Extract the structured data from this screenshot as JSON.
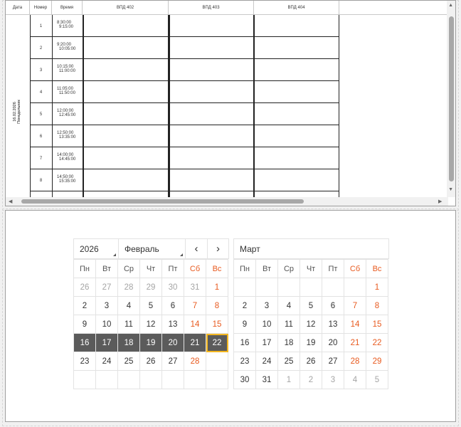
{
  "schedule": {
    "columns": [
      "Дата",
      "Номер",
      "Время",
      "ВПД 402",
      "ВПД 403",
      "ВПД 404"
    ],
    "date_label_line1": "16.02.2026",
    "date_label_line2": "Понедельник",
    "rows": [
      {
        "num": "1",
        "start": "8:30:00",
        "end": "9:15:00"
      },
      {
        "num": "2",
        "start": "9:20:00",
        "end": "10:05:00"
      },
      {
        "num": "3",
        "start": "10:15:00",
        "end": "11:00:00"
      },
      {
        "num": "4",
        "start": "11:05:00",
        "end": "11:50:00"
      },
      {
        "num": "5",
        "start": "12:00:00",
        "end": "12:45:00"
      },
      {
        "num": "6",
        "start": "12:50:00",
        "end": "13:35:00"
      },
      {
        "num": "7",
        "start": "14:00:00",
        "end": "14:45:00"
      },
      {
        "num": "8",
        "start": "14:50:00",
        "end": "15:35:00"
      }
    ],
    "scroll_up": "▲",
    "scroll_down": "▼",
    "scroll_left": "◀",
    "scroll_right": "▶"
  },
  "calendar": {
    "year": "2026",
    "month_left": "Февраль",
    "month_right": "Март",
    "prev_label": "‹",
    "next_label": "›",
    "weekdays": [
      "Пн",
      "Вт",
      "Ср",
      "Чт",
      "Пт",
      "Сб",
      "Вс"
    ],
    "feb": [
      [
        "26",
        "27",
        "28",
        "29",
        "30",
        "31",
        "1"
      ],
      [
        "2",
        "3",
        "4",
        "5",
        "6",
        "7",
        "8"
      ],
      [
        "9",
        "10",
        "11",
        "12",
        "13",
        "14",
        "15"
      ],
      [
        "16",
        "17",
        "18",
        "19",
        "20",
        "21",
        "22"
      ],
      [
        "23",
        "24",
        "25",
        "26",
        "27",
        "28",
        ""
      ],
      [
        "",
        "",
        "",
        "",
        "",
        "",
        ""
      ]
    ],
    "mar": [
      [
        "",
        "",
        "",
        "",
        "",
        "",
        "1"
      ],
      [
        "2",
        "3",
        "4",
        "5",
        "6",
        "7",
        "8"
      ],
      [
        "9",
        "10",
        "11",
        "12",
        "13",
        "14",
        "15"
      ],
      [
        "16",
        "17",
        "18",
        "19",
        "20",
        "21",
        "22"
      ],
      [
        "23",
        "24",
        "25",
        "26",
        "27",
        "28",
        "29"
      ],
      [
        "30",
        "31",
        "1",
        "2",
        "3",
        "4",
        "5"
      ]
    ],
    "accent": "#e85a1f",
    "selected_bg": "#5b5b5b",
    "today_outline": "#f3b61f"
  }
}
